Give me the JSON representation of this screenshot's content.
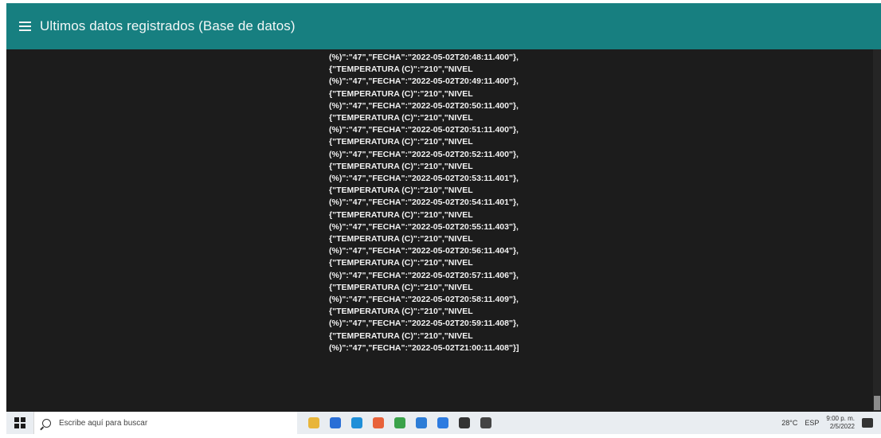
{
  "app": {
    "title": "Ultimos datos registrados (Base de datos)"
  },
  "json_lines": [
    "(%)\":\"47\",\"FECHA\":\"2022-05-02T20:48:11.400\"},",
    "{\"TEMPERATURA (C)\":\"210\",\"NIVEL",
    "(%)\":\"47\",\"FECHA\":\"2022-05-02T20:49:11.400\"},",
    "{\"TEMPERATURA (C)\":\"210\",\"NIVEL",
    "(%)\":\"47\",\"FECHA\":\"2022-05-02T20:50:11.400\"},",
    "{\"TEMPERATURA (C)\":\"210\",\"NIVEL",
    "(%)\":\"47\",\"FECHA\":\"2022-05-02T20:51:11.400\"},",
    "{\"TEMPERATURA (C)\":\"210\",\"NIVEL",
    "(%)\":\"47\",\"FECHA\":\"2022-05-02T20:52:11.400\"},",
    "{\"TEMPERATURA (C)\":\"210\",\"NIVEL",
    "(%)\":\"47\",\"FECHA\":\"2022-05-02T20:53:11.401\"},",
    "{\"TEMPERATURA (C)\":\"210\",\"NIVEL",
    "(%)\":\"47\",\"FECHA\":\"2022-05-02T20:54:11.401\"},",
    "{\"TEMPERATURA (C)\":\"210\",\"NIVEL",
    "(%)\":\"47\",\"FECHA\":\"2022-05-02T20:55:11.403\"},",
    "{\"TEMPERATURA (C)\":\"210\",\"NIVEL",
    "(%)\":\"47\",\"FECHA\":\"2022-05-02T20:56:11.404\"},",
    "{\"TEMPERATURA (C)\":\"210\",\"NIVEL",
    "(%)\":\"47\",\"FECHA\":\"2022-05-02T20:57:11.406\"},",
    "{\"TEMPERATURA (C)\":\"210\",\"NIVEL",
    "(%)\":\"47\",\"FECHA\":\"2022-05-02T20:58:11.409\"},",
    "{\"TEMPERATURA (C)\":\"210\",\"NIVEL",
    "(%)\":\"47\",\"FECHA\":\"2022-05-02T20:59:11.408\"},",
    "{\"TEMPERATURA (C)\":\"210\",\"NIVEL",
    "(%)\":\"47\",\"FECHA\":\"2022-05-02T21:00:11.408\"}]"
  ],
  "taskbar": {
    "search_placeholder": "Escribe aquí para buscar",
    "weather": "28°C",
    "lang": "ESP",
    "time": "9:00 p. m.",
    "date": "2/5/2022",
    "icons": [
      {
        "name": "folder-icon",
        "color": "#e8b53a"
      },
      {
        "name": "store-icon",
        "color": "#2a6fd6"
      },
      {
        "name": "edge-icon",
        "color": "#1f8fd8"
      },
      {
        "name": "firefox-icon",
        "color": "#e8623a"
      },
      {
        "name": "chrome-icon",
        "color": "#3aa24a"
      },
      {
        "name": "mail-icon",
        "color": "#2c7cd6"
      },
      {
        "name": "app-icon",
        "color": "#2d7be0"
      },
      {
        "name": "terminal-icon",
        "color": "#333333"
      },
      {
        "name": "window-icon",
        "color": "#444444"
      }
    ]
  },
  "colors": {
    "header": "#177f80",
    "background": "#1c1c1c",
    "text": "#f2f2f2"
  }
}
